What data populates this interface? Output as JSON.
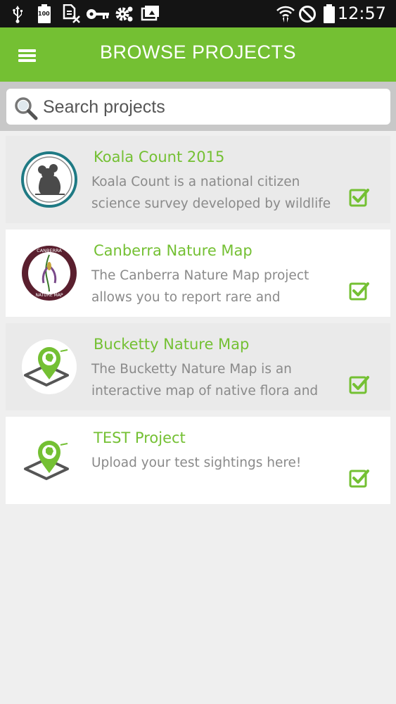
{
  "status_bar": {
    "time": "12:57",
    "battery_badge": "100",
    "icons": [
      "usb-icon",
      "battery-100-icon",
      "sim-off-icon",
      "key-icon",
      "settings-icon",
      "photo-upload-icon",
      "wifi-icon",
      "do-not-disturb-icon",
      "battery-icon"
    ]
  },
  "app_bar": {
    "title": "BROWSE PROJECTS",
    "menu_icon": "hamburger-menu-icon",
    "color": "#74c033"
  },
  "search": {
    "placeholder": "Search projects",
    "icon": "search-icon"
  },
  "projects": [
    {
      "title": "Koala Count 2015",
      "description_lines": [
        "Koala Count is a national citizen",
        "science survey developed by wildlife"
      ],
      "logo": "koala-logo",
      "selected": true
    },
    {
      "title": "Canberra Nature Map",
      "description_lines": [
        "The Canberra Nature Map project",
        "allows you to report rare and"
      ],
      "logo": "canberra-nature-map-logo",
      "logo_text_top": "CANBERRA",
      "logo_text_bottom": "NATURE MAP",
      "selected": true
    },
    {
      "title": "Bucketty Nature Map",
      "description_lines": [
        "The Bucketty Nature Map is an",
        "interactive map of native flora and"
      ],
      "logo": "map-pin-logo",
      "selected": true
    },
    {
      "title": "TEST Project",
      "description_lines": [
        "Upload your test sightings here!"
      ],
      "logo": "map-pin-logo",
      "selected": true
    }
  ],
  "colors": {
    "accent": "#74c033",
    "status_bar": "#141414",
    "background": "#efefef",
    "description_text": "#8a8a8a"
  }
}
